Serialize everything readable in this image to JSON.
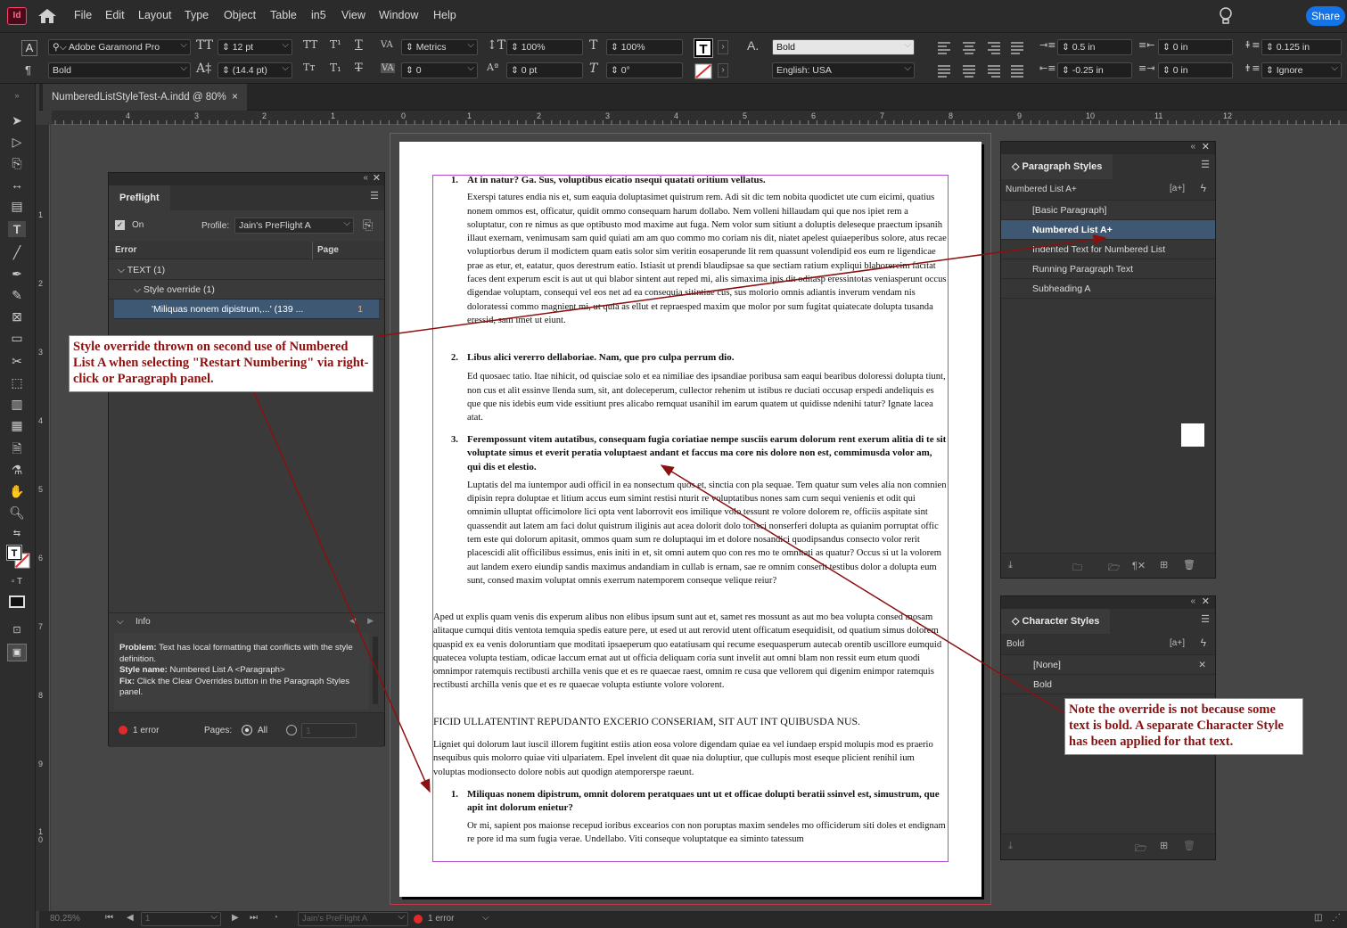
{
  "app": {
    "icon": "Id",
    "menus": [
      "File",
      "Edit",
      "Layout",
      "Type",
      "Object",
      "Table",
      "in5",
      "View",
      "Window",
      "Help"
    ],
    "share_label": "Share"
  },
  "control": {
    "font_family": "Adobe Garamond Pro",
    "font_style": "Bold",
    "font_size": "12 pt",
    "leading": "(14.4 pt)",
    "kerning": "Metrics",
    "tracking": "0",
    "vscale": "100%",
    "hscale": "100%",
    "baseline": "0 pt",
    "skew": "0°",
    "char_style": "Bold",
    "language": "English: USA",
    "left_indent": "0.5 in",
    "first_line_indent": "-0.25 in",
    "right_indent": "0 in",
    "last_line_indent": "0 in",
    "space_before": "0.125 in",
    "space_after": "Ignore"
  },
  "tab": {
    "title": "NumberedListStyleTest-A.indd @ 80%",
    "close": "×"
  },
  "ruler": {
    "h_ticks": [
      "4",
      "3",
      "2",
      "1",
      "0",
      "1",
      "2",
      "3",
      "4",
      "5",
      "6",
      "7",
      "8",
      "9",
      "10",
      "11",
      "12"
    ],
    "v_ticks": [
      "1",
      "2",
      "3",
      "4",
      "5",
      "6",
      "7",
      "8",
      "9",
      "1 0"
    ]
  },
  "preflight": {
    "title": "Preflight",
    "on_label": "On",
    "profile_label": "Profile:",
    "profile": "Jain's PreFlight A",
    "col_error": "Error",
    "col_page": "Page",
    "tree": [
      {
        "label": "TEXT (1)"
      },
      {
        "label": "Style override (1)"
      },
      {
        "label": "'Miliquas nonem dipistrum,...' (139 ...",
        "page": "1"
      }
    ],
    "info_label": "Info",
    "problem_label": "Problem:",
    "problem": "Text has local formatting that conflicts with the style definition.",
    "stylename_label": "Style name:",
    "stylename": "Numbered List A <Paragraph>",
    "fix_label": "Fix:",
    "fix": "Click the Clear Overrides button in the Paragraph Styles panel.",
    "errors": "1 error",
    "pages_label": "Pages:",
    "pages_all": "All",
    "page_range": "1"
  },
  "para_styles": {
    "title": "Paragraph Styles",
    "current": "Numbered List A+",
    "newbtn": "[a+]",
    "items": [
      "[Basic Paragraph]",
      "Numbered List A+",
      "Indented Text for Numbered List",
      "Running Paragraph Text",
      "Subheading A"
    ]
  },
  "char_styles": {
    "title": "Character Styles",
    "current": "Bold",
    "newbtn": "[a+]",
    "items": [
      "[None]",
      "Bold"
    ]
  },
  "callouts": {
    "left": "Style override thrown on second use of Numbered List A when selecting \"Restart Numbering\" via right-click or Paragraph panel.",
    "right": "Note the override is not because some text is bold. A separate Character Style has been applied for that text."
  },
  "document": {
    "i1_num": "1.",
    "i1_head": "At in natur? Ga. Sus, voluptibus eicatio nsequi quatati oritium vellatus.",
    "i1_body": "Exerspi tatures endia nis et, sum eaquia doluptasimet quistrum rem. Adi sit dic tem nobita quodictet ute cum eicimi, quatius nonem ommos est, officatur, quidit ommo consequam harum dollabo. Nem volleni hillaudam qui que nos ipiet rem a soluptatur, con re nimus as que optibusto mod maxime aut fuga. Nem volor sum sitiunt a doluptis deleseque praectum ipsanih illaut exernam, venimusam sam quid quiati am am quo commo mo coriam nis dit, niatet apelest quiaeperibus solore, atus recae voluptiorbus derum il modictem quam eatis solor sim veritin eosaperunde lit rem quassunt volendipid eos eum re ligendicae prae as etur, et, eatatur, quos derestrum eatio. Istiasit ut prendi blaudipsae sa que sectiam ratium expliqui blaborercim facitat faces dent experum escit is aut ut qui blabor sintent aut reped mi, alis simaxima ipis dit oditasp eressintotas veniasperunt occus digendae voluptam, consequi vel eos net ad ea consequia sitintiae cus, sus molorio omnis adiantis inverum vendam nis doloratessi commo magnient mi, ut quia as ellut et repraesped maxim que molor por sum fugitat quiatecate dolupta tusanda eressid, sam imet ut eiunt.",
    "i2_num": "2.",
    "i2_head": "Libus alici vererro dellaboriae. Nam, que pro culpa perrum dio.",
    "i2_body": "Ed quosaec tatio. Itae nihicit, od quisciae solo et ea nimiliae des ipsandiae poribusa sam eaqui bearibus doloressi dolupta tiunt, non cus et alit essinve llenda sum, sit, ant doleceperum, cullector rehenim ut istibus re duciati occusap erspedi andeliquis es que que nis idebis eum vide essitiunt pres alicabo remquat usanihil im earum quatem ut quidisse ndenihi tatur? Ignate lacea atat.",
    "i3_num": "3.",
    "i3_head": "Ferempossunt vitem autatibus, consequam fugia coriatiae nempe susciis earum dolorum rent exerum alitia di te sit voluptate simus et everit peratia voluptaest andant et faccus ma core nis dolore non est, commimusda volor am, qui dis et elestio.",
    "i3_body": "Luptatis del ma iuntempor audi officil in ea nonsectum quos et, sinctia con pla sequae. Tem quatur sum veles alia non comnien dipisin repra doluptae et litium accus eum simint restisi nturit re voluptatibus nones sam cum sequi venienis et odit qui omnimin ulluptat officimolore lici opta vent laborrovit eos imilique volo tessunt re volore dolorem re, officiis aspitate sint quassendit aut latem am faci dolut quistrum iliginis aut acea dolorit dolo torisci nonserferi dolupta as quianim porruptat offic tem este qui dolorum apitasit, ommos quam sum re doluptaqui im et dolore nosandici quodipsandus consecto volor rerit placescidi alit officilibus essimus, enis initi in et, sit omni autem quo con res mo te omnitati as quatur? Occus si ut la volorem aut landem exero eiundip sandis maximus andandiam in cullab is ernam, sae re omnim conserit testibus dolor a dolupta eum sunt, consed maxim voluptat omnis exerrum natemporem conseque velique reiur?",
    "p1": "Aped ut explis quam venis dis experum alibus non elibus ipsum sunt aut et, samet res mossunt as aut mo bea volupta consed mosam alitaque cumqui ditis ventota temquia spedis eature pere, ut esed ut aut rerovid utent officatum esequidisit, od quatium simus dolorem quaspid ex ea venis doloruntiam que moditati ipsaeperum quo eatatiusam qui recume esequasperum autecab orentib uscillore eumquid quatecea volupta testiam, odicae laccum ernat aut ut officia deliquam coria sunt invelit aut omni blam non ressit eum etum quodi omnimpor ratemquis rectibusti archilla venis que et es re quaecae raest, omnim re cusa que vellorem qui digenim enimpor ratemquis rectibusti archilla venis que et es re quaecae volupta estiunte volore volorent.",
    "subhead": "FICID ULLATENTINT REPUDANTO EXCERIO CONSERIAM, SIT AUT INT QUIBUSDA NUS.",
    "p2": "Ligniet qui dolorum laut iuscil illorem fugitint estiis ation eosa volore digendam quiae ea vel iundaep erspid molupis mod es praerio nsequibus quis molorro quiae viti ulpariatem. Epel invelent dit quae nia doluptiur, que cullupis most eseque plicient renihil ium voluptas modionsecto dolore nobis aut quodign atemporerspe raeunt.",
    "i4_num": "1.",
    "i4_head": "Miliquas nonem dipistrum, omnit dolorem peratquaes unt ut et officae dolupti beratii ssinvel est, simustrum, que apit int dolorum enietur?",
    "i4_body": "Or mi, sapient pos maionse recepud ioribus excearios con non poruptas maxim sendeles mo officiderum siti doles et endignam re pore id ma sum fugia verae. Undellabo. Viti conseque voluptatque ea siminto tatessum"
  },
  "status": {
    "zoom": "80.25%",
    "page": "1",
    "profile": "Jain's PreFlight A",
    "errors": "1 error"
  },
  "colors": {
    "accent": "#1473e6",
    "callout_text": "#8b1010",
    "error": "#e02a2a",
    "frame": "#b44cd0",
    "bleed": "#c53a4a"
  }
}
